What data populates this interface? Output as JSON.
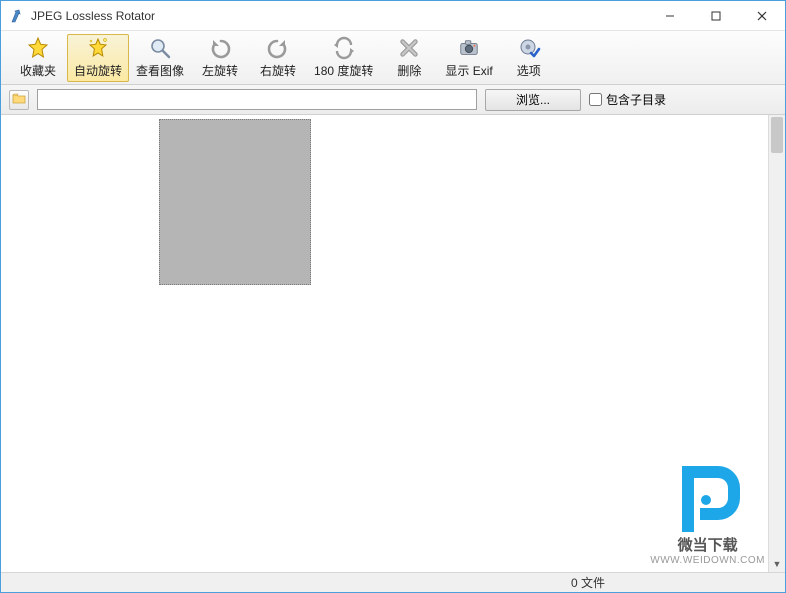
{
  "window": {
    "title": "JPEG Lossless Rotator"
  },
  "toolbar": {
    "favorites": "收藏夹",
    "auto_rotate": "自动旋转",
    "view_image": "查看图像",
    "rotate_left": "左旋转",
    "rotate_right": "右旋转",
    "rotate_180": "180 度旋转",
    "delete": "删除",
    "show_exif": "显示 Exif",
    "options": "选项"
  },
  "pathbar": {
    "path_value": "",
    "browse_label": "浏览...",
    "include_sub_label": "包含子目录",
    "include_sub_checked": false
  },
  "status": {
    "file_count": "0 文件"
  },
  "watermark": {
    "text": "微当下载",
    "url": "WWW.WEIDOWN.COM"
  }
}
